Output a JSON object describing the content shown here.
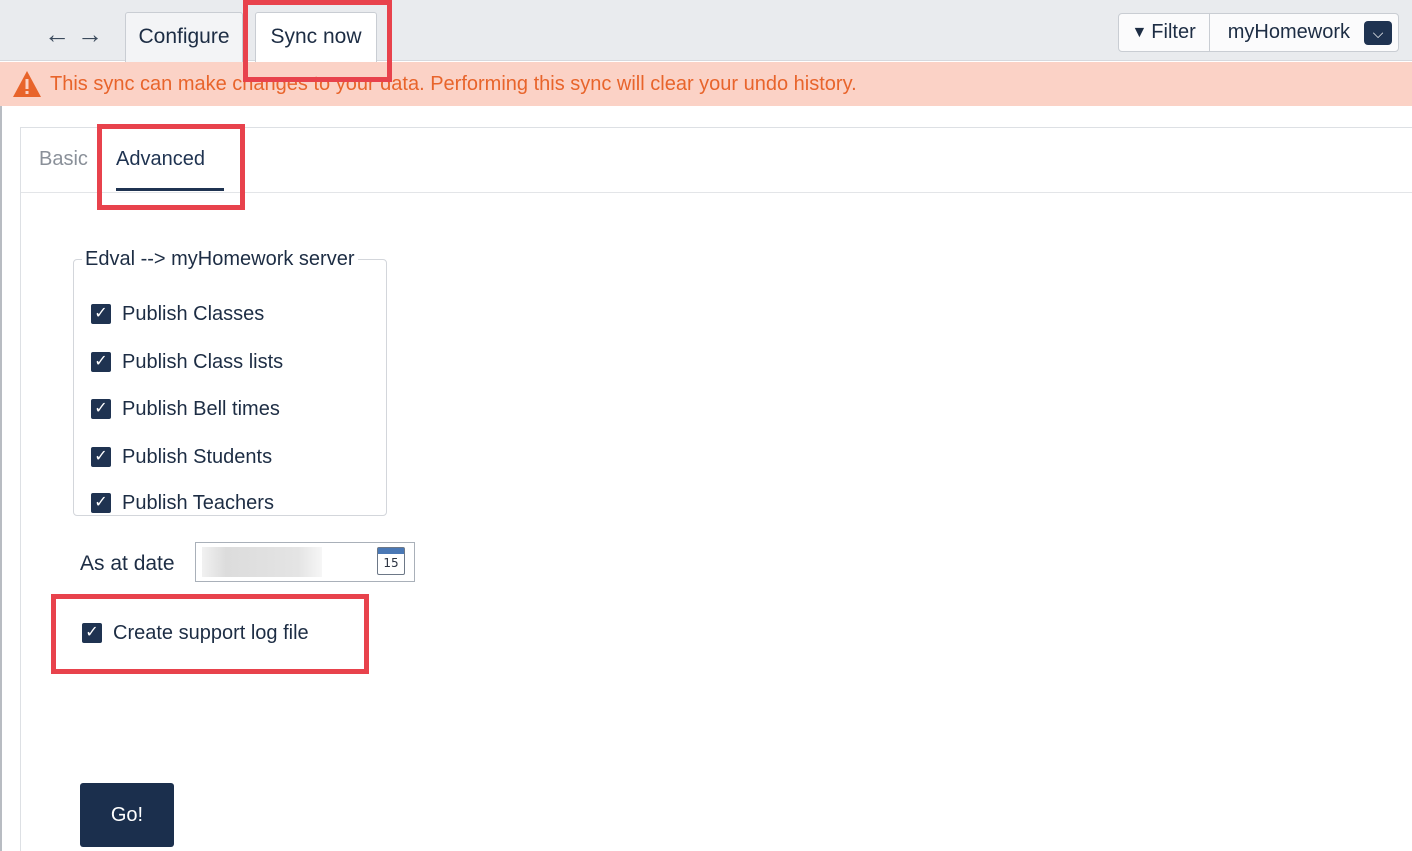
{
  "toolbar": {
    "back_icon": "arrow-left-icon",
    "forward_icon": "arrow-right-icon",
    "tabs": [
      {
        "label": "Configure",
        "active": false
      },
      {
        "label": "Sync now",
        "active": true
      }
    ],
    "filter_label": "Filter",
    "app_selector": "myHomework"
  },
  "warning": {
    "text": "This sync can make changes to your data. Performing this sync will clear your undo history.",
    "color": "#e8642b",
    "background": "#fbd2c6"
  },
  "subtabs": [
    {
      "label": "Basic",
      "active": false
    },
    {
      "label": "Advanced",
      "active": true
    }
  ],
  "publish_group": {
    "legend": "Edval --> myHomework server",
    "options": [
      {
        "label": "Publish Classes",
        "checked": true
      },
      {
        "label": "Publish Class lists",
        "checked": true
      },
      {
        "label": "Publish Bell times",
        "checked": true
      },
      {
        "label": "Publish Students",
        "checked": true
      },
      {
        "label": "Publish Teachers",
        "checked": true
      }
    ]
  },
  "date": {
    "label": "As at date",
    "calendar_day": "15"
  },
  "support_log": {
    "label": "Create support log file",
    "checked": true
  },
  "go_button": "Go!",
  "colors": {
    "accent": "#1f3351",
    "highlight": "#e8424c"
  }
}
